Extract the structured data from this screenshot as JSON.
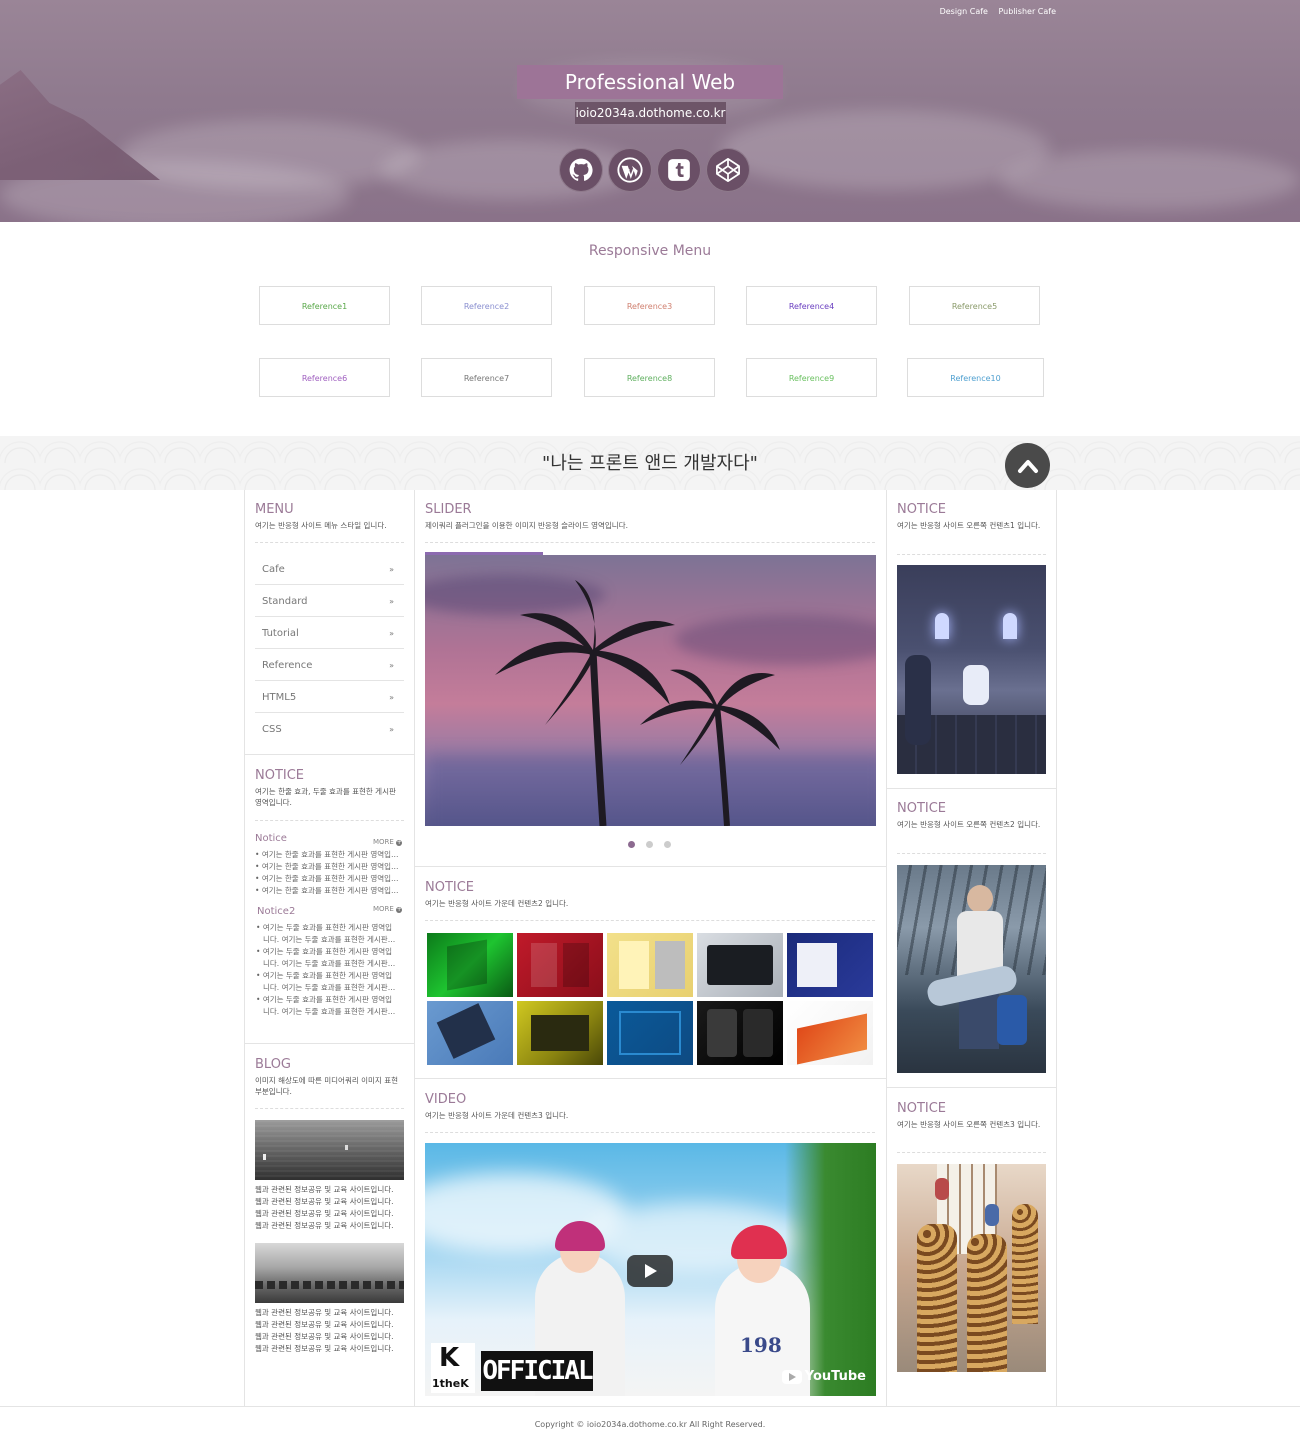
{
  "header": {
    "top_links": [
      "Design Cafe",
      "Publisher Cafe"
    ],
    "title": "Professional Web Publisher",
    "url": "ioio2034a.dothome.co.kr",
    "socials": [
      "github-icon",
      "wordpress-icon",
      "tumblr-icon",
      "codepen-icon"
    ]
  },
  "responsive_menu": {
    "title": "Responsive Menu",
    "items": [
      "Reference1",
      "Reference2",
      "Reference3",
      "Reference4",
      "Reference5",
      "Reference6",
      "Reference7",
      "Reference8",
      "Reference9",
      "Reference10"
    ],
    "colors": [
      "#5aa84a",
      "#8a8fd0",
      "#d08070",
      "#6a3fc0",
      "#8a9a6a",
      "#a060c0",
      "#777777",
      "#60b060",
      "#6ac060",
      "#50a0d0"
    ]
  },
  "quote": "\"나는 프론트 앤드 개발자다\"",
  "left": {
    "menu": {
      "title": "MENU",
      "desc": "여기는 반응형 사이트 메뉴 스타일 입니다.",
      "items": [
        "Cafe",
        "Standard",
        "Tutorial",
        "Reference",
        "HTML5",
        "CSS"
      ],
      "arrow": "»"
    },
    "notice": {
      "title": "NOTICE",
      "desc": "여기는 한줄 효과, 두줄 효과를 표현한 게시판 영역입니다.",
      "list1_title": "Notice",
      "list2_title": "Notice2",
      "more": "MORE",
      "list1": [
        "여기는 한줄 효과를 표현한 게시판 영역입니다.",
        "여기는 한줄 효과를 표현한 게시판 영역입니다.",
        "여기는 한줄 효과를 표현한 게시판 영역입니다.",
        "여기는 한줄 효과를 표현한 게시판 영역입니다."
      ],
      "list2": [
        [
          "여기는 두줄 효과를 표현한 게시판 영역입",
          "니다. 여기는 두줄 효과를 표현한 게시판"
        ],
        [
          "여기는 두줄 효과를 표현한 게시판 영역입",
          "니다. 여기는 두줄 효과를 표현한 게시판"
        ],
        [
          "여기는 두줄 효과를 표현한 게시판 영역입",
          "니다. 여기는 두줄 효과를 표현한 게시판"
        ],
        [
          "여기는 두줄 효과를 표현한 게시판 영역입",
          "니다. 여기는 두줄 효과를 표현한 게시판"
        ]
      ]
    },
    "blog": {
      "title": "BLOG",
      "desc": "이미지 해상도에 따른 미디어쿼리 이미지 표현 부분입니다.",
      "text": [
        "웹과 관련된 정보공유 및 교육 사이트입니다.",
        "웹과 관련된 정보공유 및 교육 사이트입니다.",
        "웹과 관련된 정보공유 및 교육 사이트입니다.",
        "웹과 관련된 정보공유 및 교육 사이트입니다."
      ]
    }
  },
  "center": {
    "slider": {
      "title": "SLIDER",
      "desc": "제이쿼리 플러그인을 이용한 이미지 반응형 슬라이드 영역입니다.",
      "dots": 3
    },
    "notice": {
      "title": "NOTICE",
      "desc": "여기는 반응형 사이트 가운데 컨텐츠2 입니다."
    },
    "video": {
      "title": "VIDEO",
      "desc": "여기는 반응형 사이트 가운데 컨텐츠3 입니다.",
      "brand_k": "K",
      "brand_name": "1theK",
      "badge": "OFFICIAL",
      "youtube": "YouTube",
      "jersey": "198"
    }
  },
  "right": {
    "notices": [
      {
        "title": "NOTICE",
        "desc": "여기는 반응형 사이트 오른쪽 컨텐츠1 입니다."
      },
      {
        "title": "NOTICE",
        "desc": "여기는 반응형 사이트 오른쪽 컨텐츠2 입니다."
      },
      {
        "title": "NOTICE",
        "desc": "여기는 반응형 사이트 오른쪽 컨텐츠3 입니다."
      }
    ]
  },
  "footer": "Copyright © ioio2034a.dothome.co.kr All Right Reserved."
}
